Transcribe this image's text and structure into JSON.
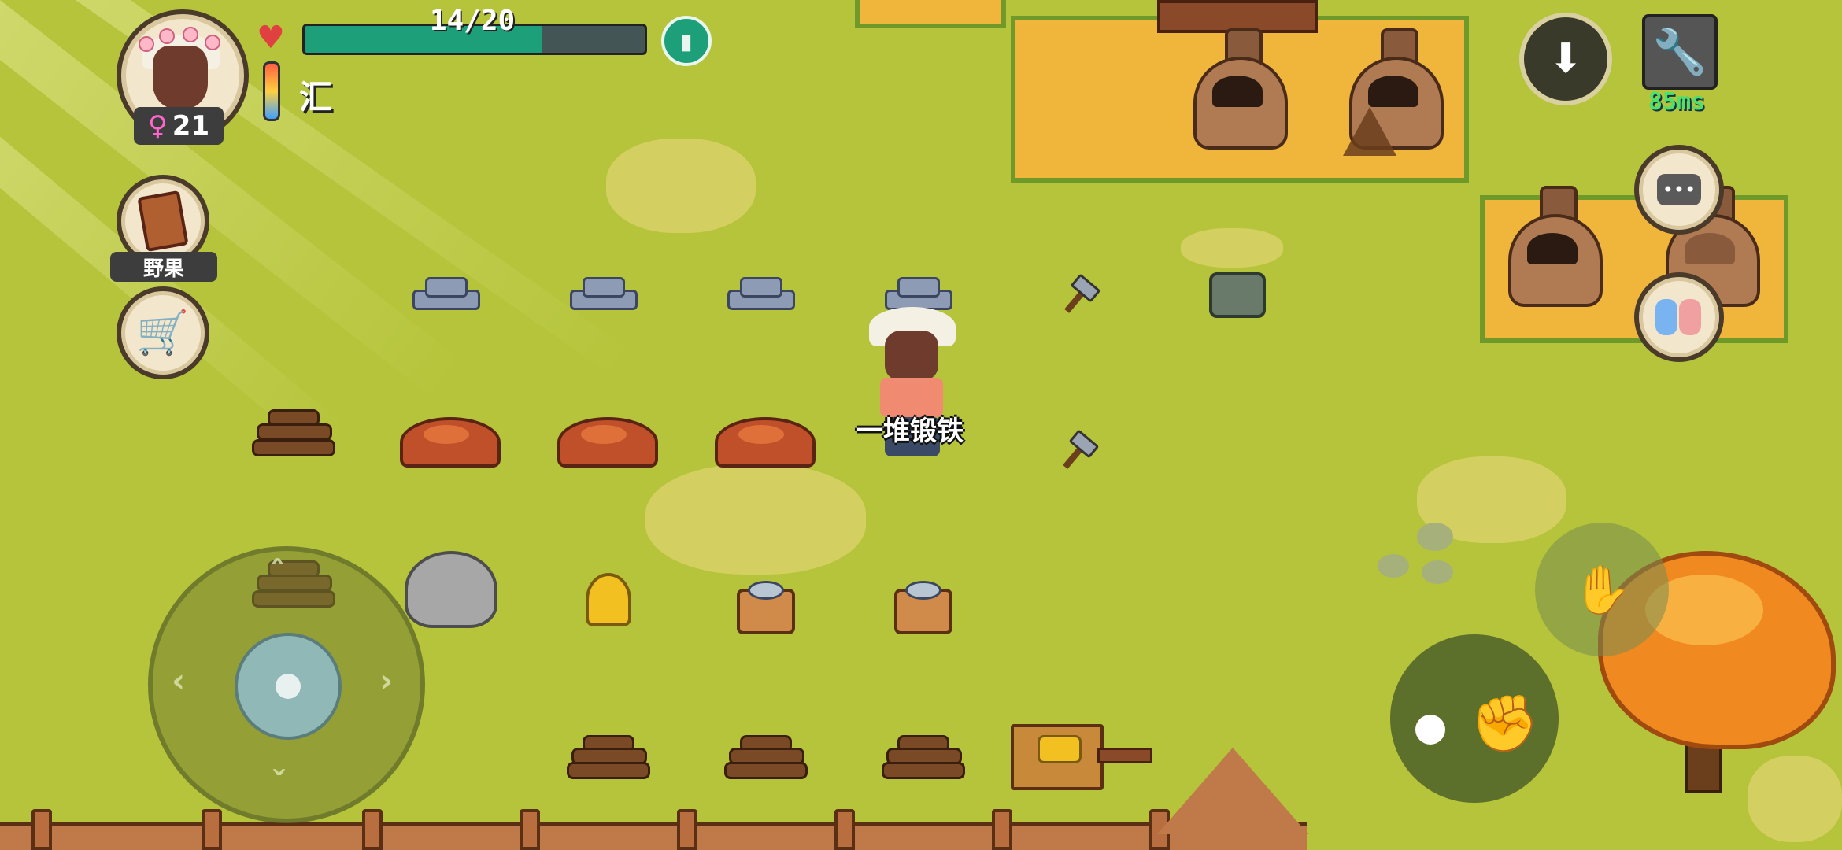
{
  "player": {
    "age": "21",
    "gender_symbol": "♀",
    "hp_text": "14/20",
    "hp_fraction": 0.7,
    "temperature_label": "汇"
  },
  "hud": {
    "food_label": "野果",
    "ping": "85ms"
  },
  "world": {
    "target_label": "一堆锻铁"
  },
  "icons": {
    "heart": "heart-icon",
    "potion": "bottle-icon",
    "thermometer": "thermometer-icon",
    "food": "berry-basket-icon",
    "shop": "shopping-cart-icon",
    "note": "drop-item-icon",
    "settings": "wrench-icon",
    "chat": "chat-bubble-icon",
    "social": "friends-icon",
    "pickup": "pickup-hand-icon",
    "throw": "throw-hand-icon"
  },
  "colors": {
    "grass": "#b5c43a",
    "hp": "#1da07a",
    "ping": "#4ee06a",
    "dirt": "#f0b63c"
  }
}
